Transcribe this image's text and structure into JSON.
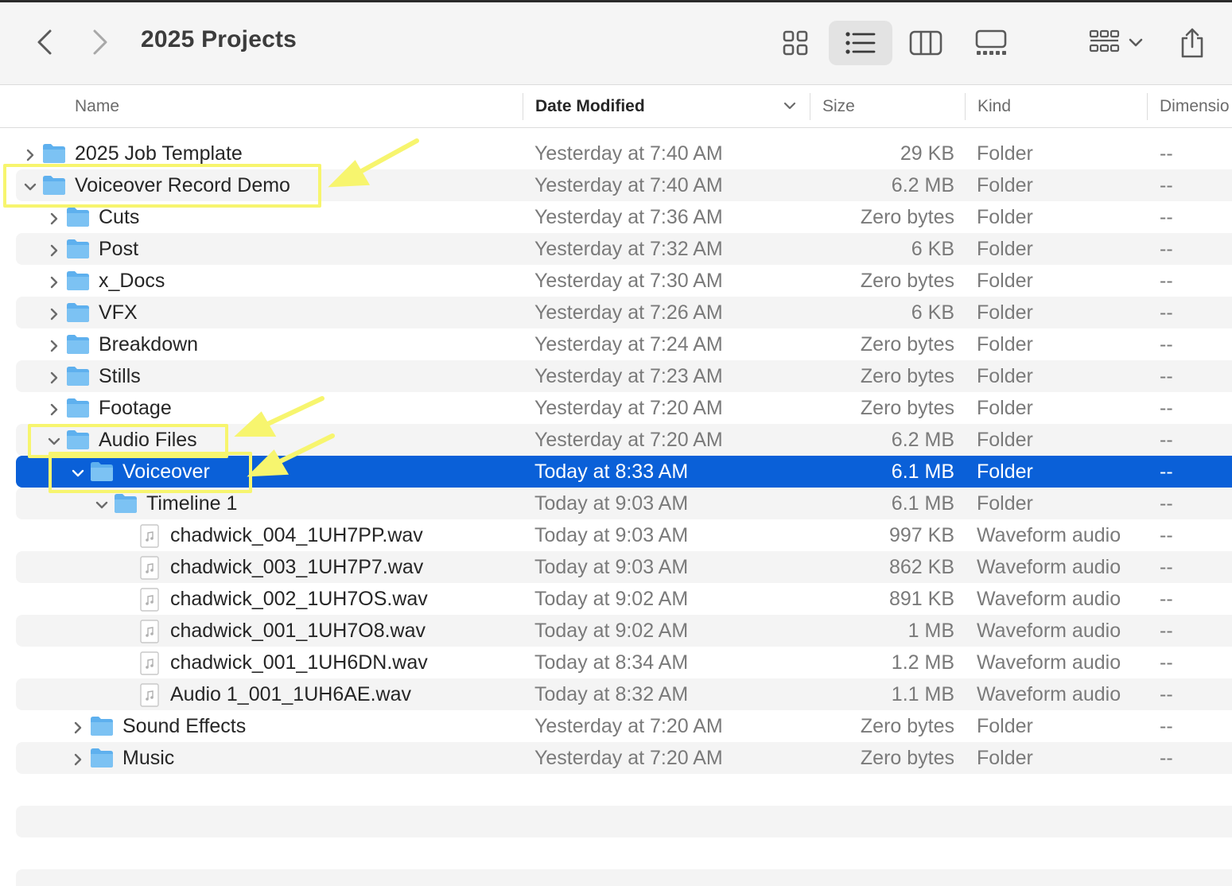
{
  "window": {
    "title": "2025 Projects"
  },
  "toolbar": {
    "back_icon": "chevron-left-icon",
    "forward_icon": "chevron-right-icon",
    "view_icons": [
      "icon-view-icon",
      "list-view-icon",
      "column-view-icon",
      "gallery-view-icon"
    ],
    "active_view": "list",
    "group_icon": "group-by-icon",
    "share_icon": "share-icon"
  },
  "columns": {
    "name": "Name",
    "date": "Date Modified",
    "size": "Size",
    "kind": "Kind",
    "dimensions": "Dimensio"
  },
  "rows": [
    {
      "name": "2025 Job Template",
      "date": "Yesterday at 7:40 AM",
      "size": "29 KB",
      "kind": "Folder",
      "dim": "--",
      "level": 0,
      "type": "folder",
      "expanded": false
    },
    {
      "name": "Voiceover Record Demo",
      "date": "Yesterday at 7:40 AM",
      "size": "6.2 MB",
      "kind": "Folder",
      "dim": "--",
      "level": 0,
      "type": "folder",
      "expanded": true
    },
    {
      "name": "Cuts",
      "date": "Yesterday at 7:36 AM",
      "size": "Zero bytes",
      "kind": "Folder",
      "dim": "--",
      "level": 1,
      "type": "folder",
      "expanded": false
    },
    {
      "name": "Post",
      "date": "Yesterday at 7:32 AM",
      "size": "6 KB",
      "kind": "Folder",
      "dim": "--",
      "level": 1,
      "type": "folder",
      "expanded": false
    },
    {
      "name": "x_Docs",
      "date": "Yesterday at 7:30 AM",
      "size": "Zero bytes",
      "kind": "Folder",
      "dim": "--",
      "level": 1,
      "type": "folder",
      "expanded": false
    },
    {
      "name": "VFX",
      "date": "Yesterday at 7:26 AM",
      "size": "6 KB",
      "kind": "Folder",
      "dim": "--",
      "level": 1,
      "type": "folder",
      "expanded": false
    },
    {
      "name": "Breakdown",
      "date": "Yesterday at 7:24 AM",
      "size": "Zero bytes",
      "kind": "Folder",
      "dim": "--",
      "level": 1,
      "type": "folder",
      "expanded": false
    },
    {
      "name": "Stills",
      "date": "Yesterday at 7:23 AM",
      "size": "Zero bytes",
      "kind": "Folder",
      "dim": "--",
      "level": 1,
      "type": "folder",
      "expanded": false
    },
    {
      "name": "Footage",
      "date": "Yesterday at 7:20 AM",
      "size": "Zero bytes",
      "kind": "Folder",
      "dim": "--",
      "level": 1,
      "type": "folder",
      "expanded": false
    },
    {
      "name": "Audio Files",
      "date": "Yesterday at 7:20 AM",
      "size": "6.2 MB",
      "kind": "Folder",
      "dim": "--",
      "level": 1,
      "type": "folder",
      "expanded": true
    },
    {
      "name": "Voiceover",
      "date": "Today at 8:33 AM",
      "size": "6.1 MB",
      "kind": "Folder",
      "dim": "--",
      "level": 2,
      "type": "folder",
      "expanded": true,
      "selected": true
    },
    {
      "name": "Timeline 1",
      "date": "Today at 9:03 AM",
      "size": "6.1 MB",
      "kind": "Folder",
      "dim": "--",
      "level": 3,
      "type": "folder",
      "expanded": true
    },
    {
      "name": "chadwick_004_1UH7PP.wav",
      "date": "Today at 9:03 AM",
      "size": "997 KB",
      "kind": "Waveform audio",
      "dim": "--",
      "level": 4,
      "type": "audio"
    },
    {
      "name": "chadwick_003_1UH7P7.wav",
      "date": "Today at 9:03 AM",
      "size": "862 KB",
      "kind": "Waveform audio",
      "dim": "--",
      "level": 4,
      "type": "audio"
    },
    {
      "name": "chadwick_002_1UH7OS.wav",
      "date": "Today at 9:02 AM",
      "size": "891 KB",
      "kind": "Waveform audio",
      "dim": "--",
      "level": 4,
      "type": "audio"
    },
    {
      "name": "chadwick_001_1UH7O8.wav",
      "date": "Today at 9:02 AM",
      "size": "1 MB",
      "kind": "Waveform audio",
      "dim": "--",
      "level": 4,
      "type": "audio"
    },
    {
      "name": "chadwick_001_1UH6DN.wav",
      "date": "Today at 8:34 AM",
      "size": "1.2 MB",
      "kind": "Waveform audio",
      "dim": "--",
      "level": 4,
      "type": "audio"
    },
    {
      "name": "Audio 1_001_1UH6AE.wav",
      "date": "Today at 8:32 AM",
      "size": "1.1 MB",
      "kind": "Waveform audio",
      "dim": "--",
      "level": 4,
      "type": "audio"
    },
    {
      "name": "Sound Effects",
      "date": "Yesterday at 7:20 AM",
      "size": "Zero bytes",
      "kind": "Folder",
      "dim": "--",
      "level": 2,
      "type": "folder",
      "expanded": false
    },
    {
      "name": "Music",
      "date": "Yesterday at 7:20 AM",
      "size": "Zero bytes",
      "kind": "Folder",
      "dim": "--",
      "level": 2,
      "type": "folder",
      "expanded": false
    }
  ],
  "colors": {
    "selection": "#0a60d8",
    "stripe": "#f4f4f4",
    "folder": "#6cb7ef",
    "annotation": "#f7f56e"
  }
}
